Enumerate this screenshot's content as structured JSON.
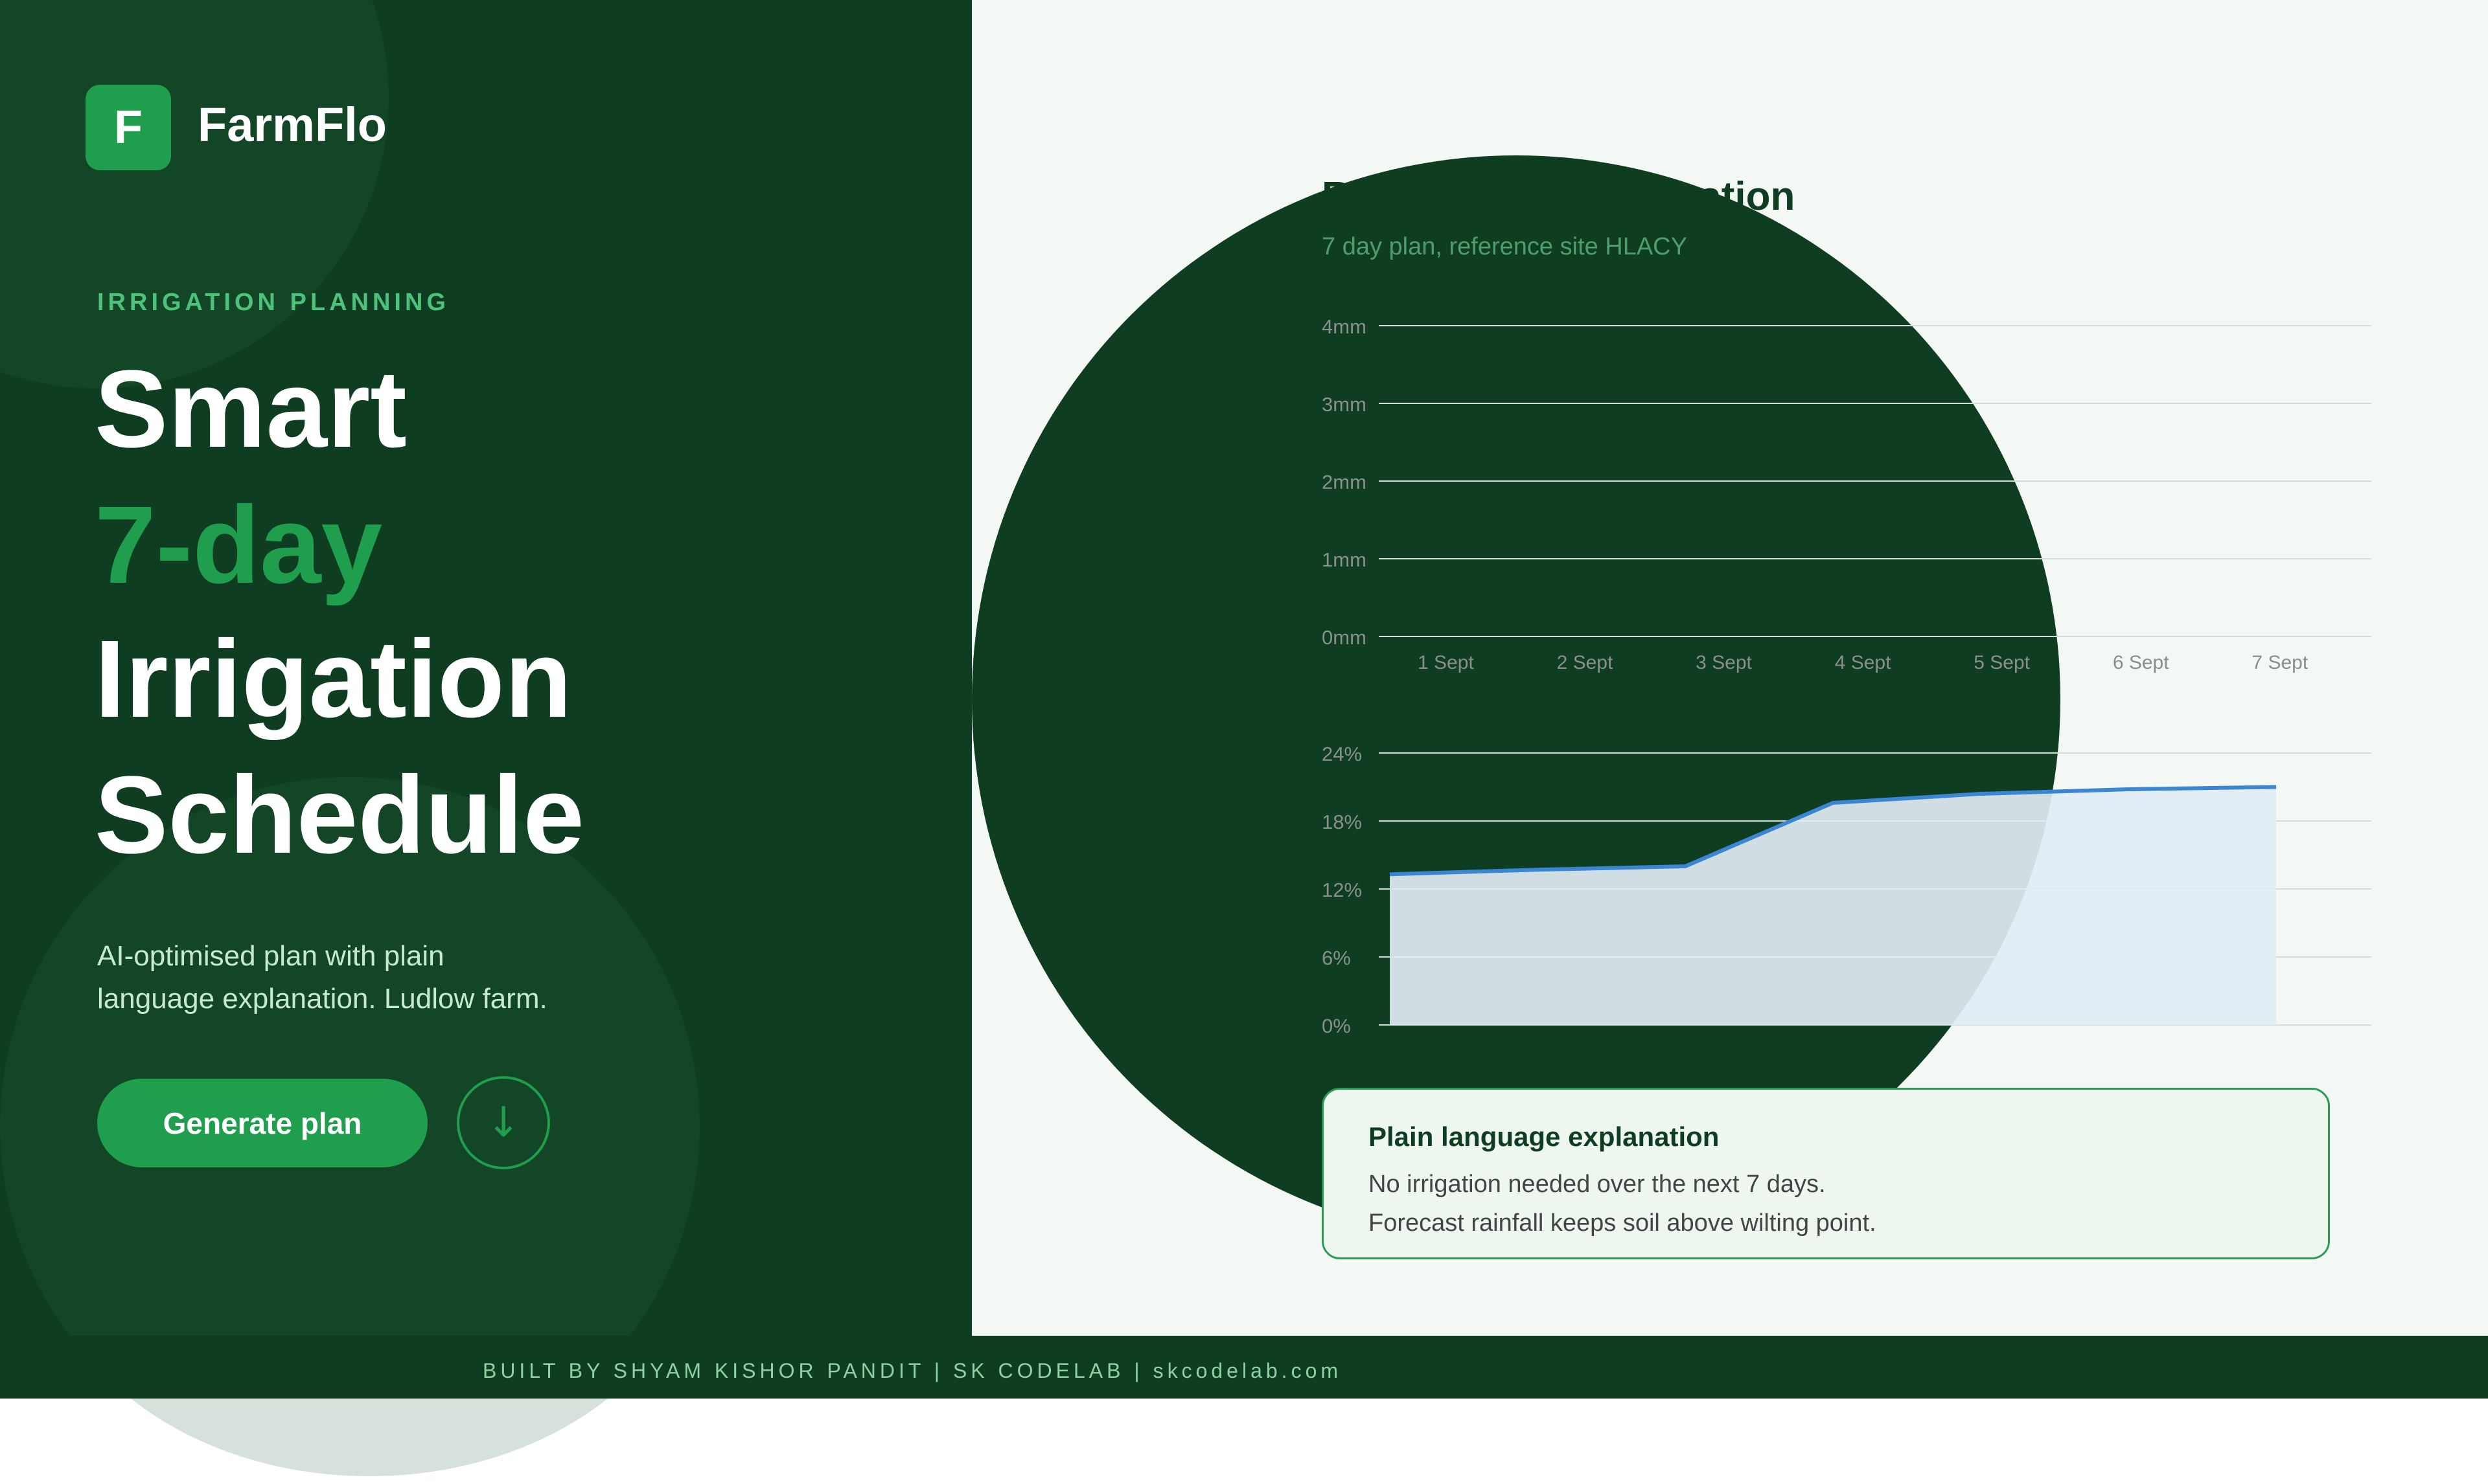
{
  "brand": {
    "logo_letter": "F",
    "name": "FarmFlo"
  },
  "hero": {
    "eyebrow": "IRRIGATION PLANNING",
    "title_line1": "Smart",
    "title_line2": "7-day",
    "title_line3": "Irrigation",
    "title_line4": "Schedule",
    "subtitle_line1": "AI-optimised plan with plain",
    "subtitle_line2": "language explanation. Ludlow farm.",
    "cta_label": "Generate plan",
    "secondary_icon": "arrow-down-icon"
  },
  "card": {
    "title": "Recommended irrigation",
    "subtitle": "7 day plan, reference site HLACY"
  },
  "chart_data": [
    {
      "type": "bar",
      "categories": [
        "1 Sept",
        "2 Sept",
        "3 Sept",
        "4 Sept",
        "5 Sept",
        "6 Sept",
        "7 Sept"
      ],
      "values": [
        0,
        0,
        0,
        0,
        0,
        0,
        0
      ],
      "y_ticks": [
        "0mm",
        "1mm",
        "2mm",
        "3mm",
        "4mm"
      ],
      "ylim": [
        0,
        4
      ],
      "grid": true
    },
    {
      "type": "area",
      "x": [
        "1 Sept",
        "2 Sept",
        "3 Sept",
        "4 Sept",
        "5 Sept",
        "6 Sept",
        "7 Sept"
      ],
      "values": [
        13.3,
        13.7,
        14.0,
        19.6,
        20.4,
        20.8,
        21.0
      ],
      "y_ticks": [
        "0%",
        "6%",
        "12%",
        "18%",
        "24%"
      ],
      "ylim": [
        0,
        24
      ],
      "grid": true,
      "line_color": "#3a86d4",
      "fill_color": "#e1ecf5"
    }
  ],
  "explanation": {
    "title": "Plain language explanation",
    "line1": "No irrigation needed over the next 7 days.",
    "line2": "Forecast rainfall keeps soil above wilting point."
  },
  "footer": {
    "text": "BUILT BY SHYAM KISHOR PANDIT | SK CODELAB | skcodelab.com"
  },
  "colors": {
    "dark_green": "#0e3d21",
    "accent_green": "#1f9e4e",
    "light_bg": "#f4f8f5",
    "line_blue": "#3a86d4"
  }
}
